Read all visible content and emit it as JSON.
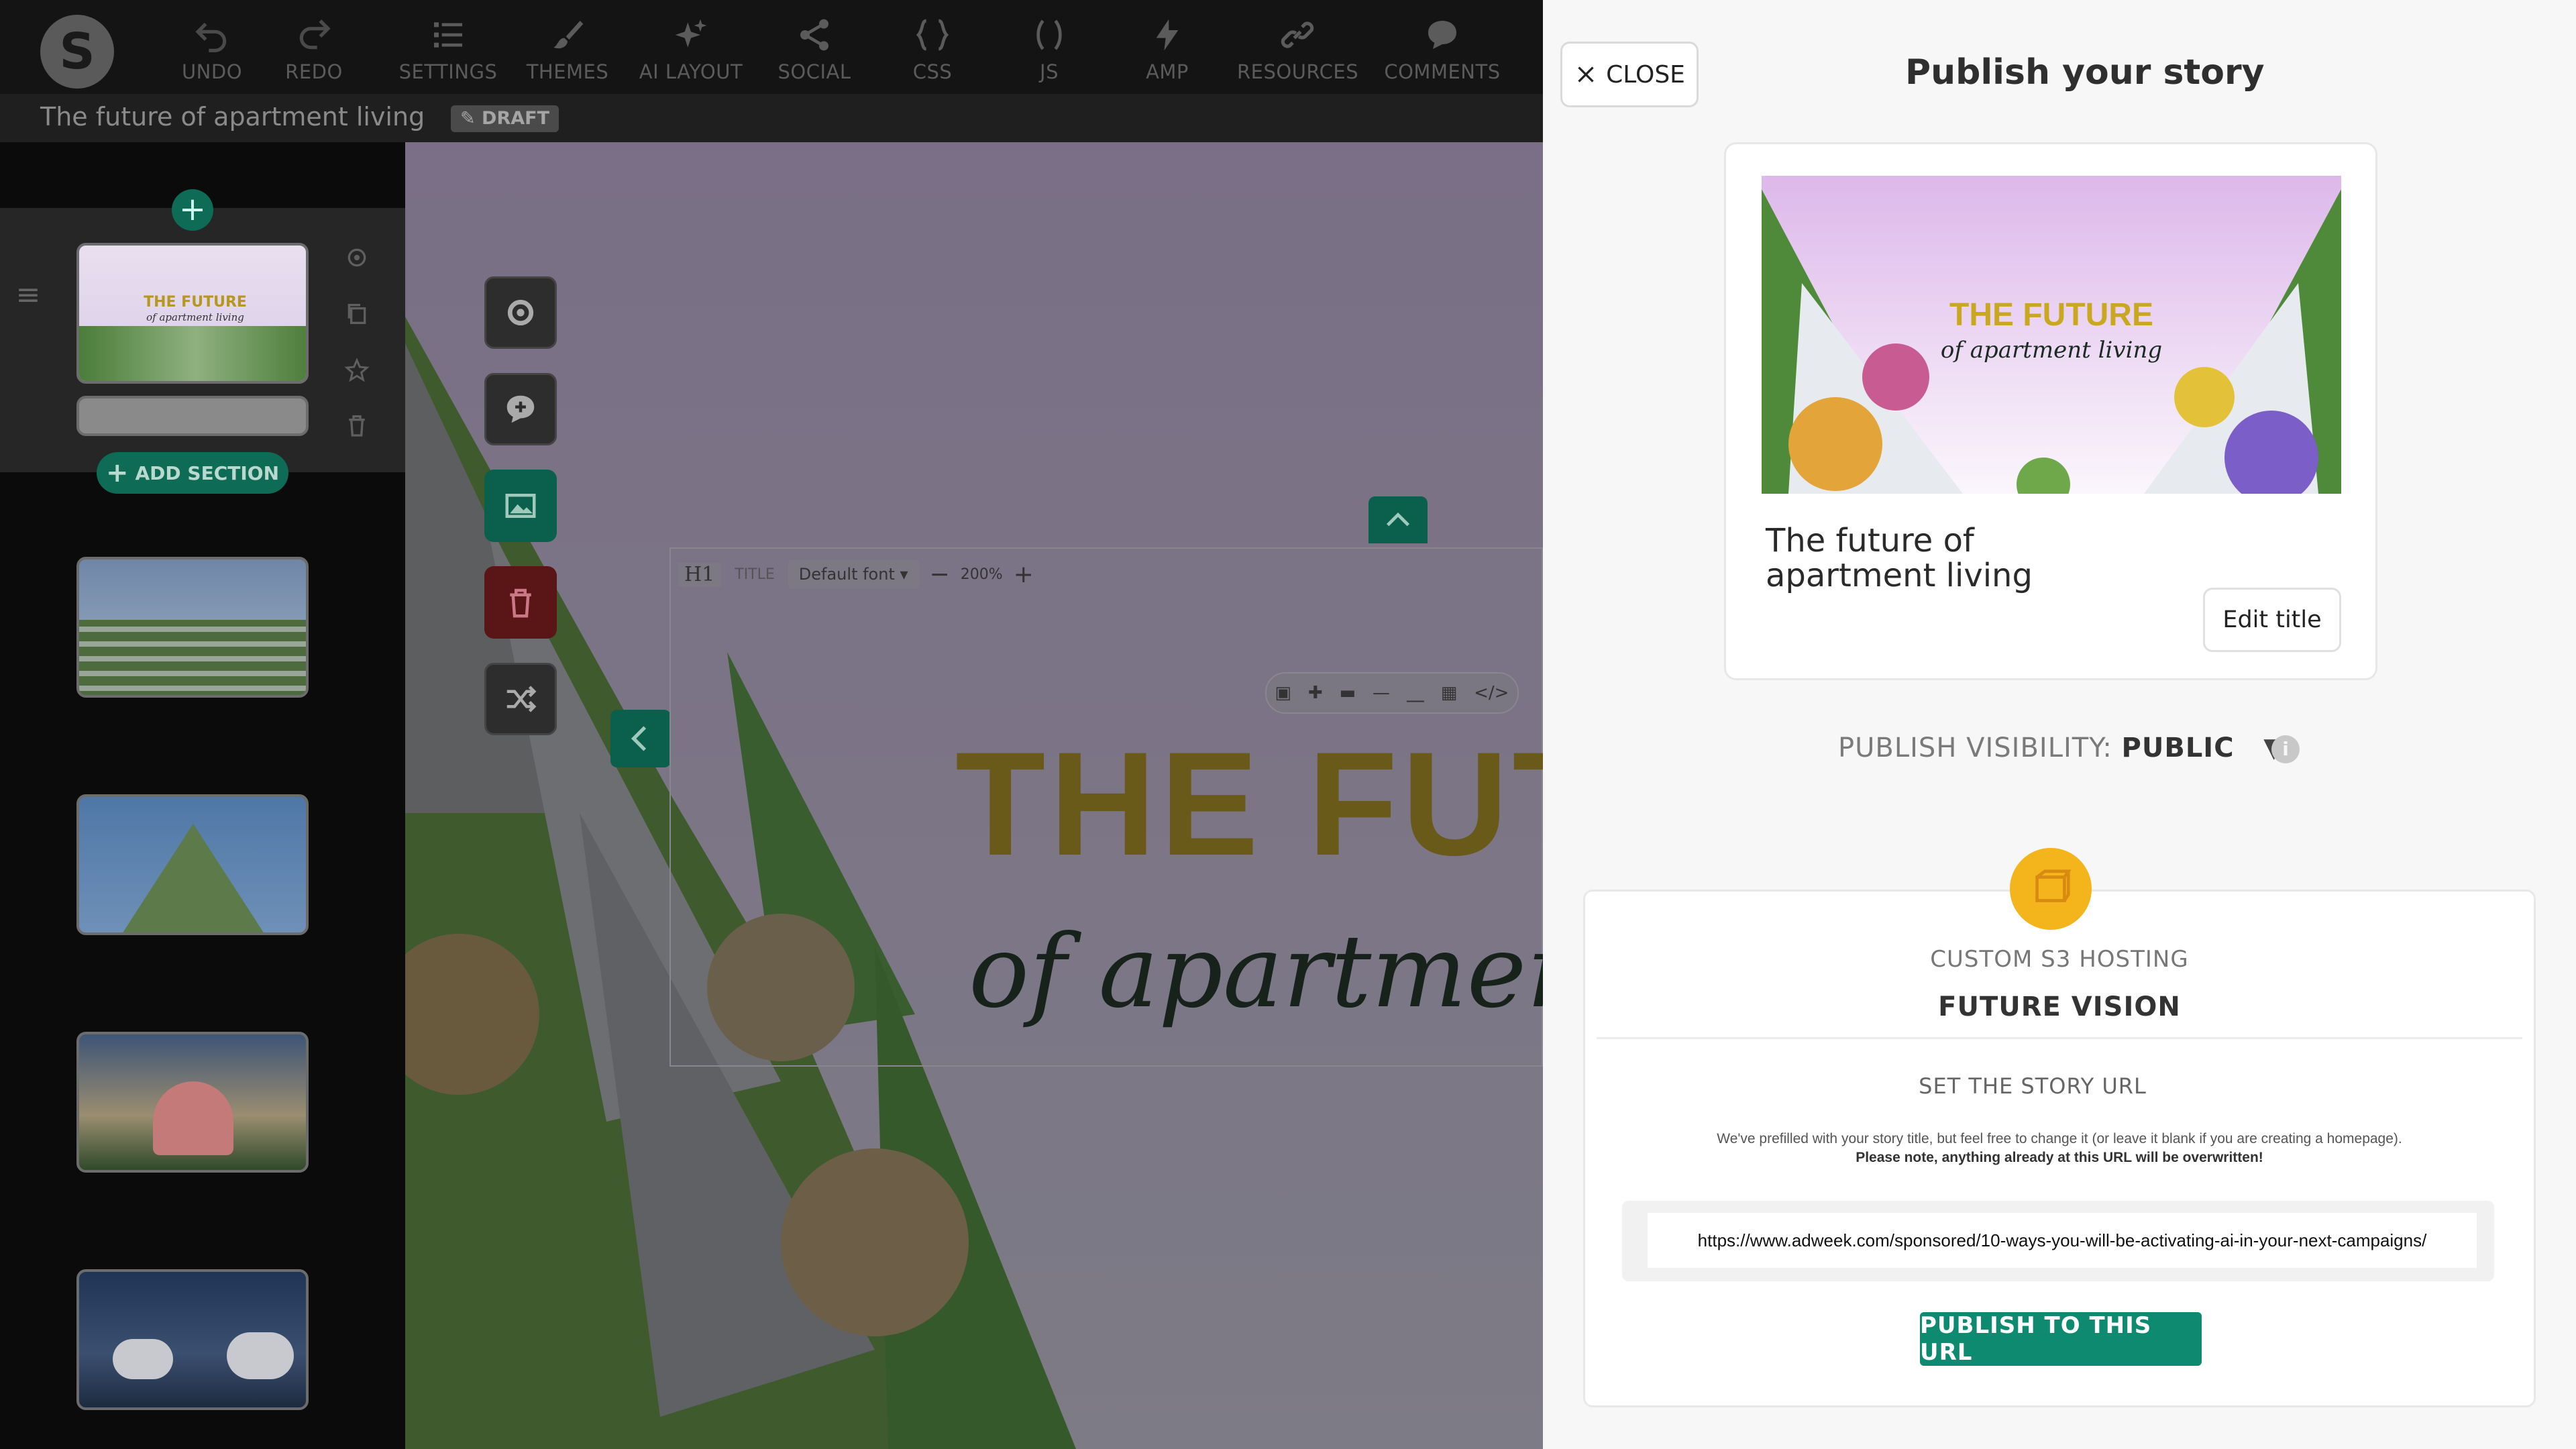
{
  "toolbar": {
    "logo": "S",
    "items": [
      {
        "label": "UNDO",
        "icon": "undo-icon"
      },
      {
        "label": "REDO",
        "icon": "redo-icon"
      },
      {
        "label": "SETTINGS",
        "icon": "list-icon"
      },
      {
        "label": "THEMES",
        "icon": "brush-icon"
      },
      {
        "label": "AI LAYOUT",
        "icon": "sparkle-icon"
      },
      {
        "label": "SOCIAL",
        "icon": "share-icon"
      },
      {
        "label": "CSS",
        "icon": "braces-icon"
      },
      {
        "label": "JS",
        "icon": "parens-icon"
      },
      {
        "label": "AMP",
        "icon": "bolt-icon"
      },
      {
        "label": "RESOURCES",
        "icon": "link-icon"
      },
      {
        "label": "COMMENTS",
        "icon": "chat-icon"
      }
    ]
  },
  "story": {
    "title": "The future of apartment living",
    "status": "DRAFT"
  },
  "sidebar": {
    "add_section_label": "ADD SECTION",
    "thumb_text": {
      "title": "THE FUTURE",
      "subtitle": "of apartment living"
    }
  },
  "editor": {
    "heading_tag": "H1",
    "element_type": "TITLE",
    "font": "Default font",
    "zoom": "200%",
    "headline": "THE FUTURE",
    "subheadline": "of apartment living"
  },
  "publish": {
    "close_label": "CLOSE",
    "title": "Publish your story",
    "card_headline": "THE FUTURE",
    "card_subheadline": "of apartment living",
    "card_title": "The future of apartment living",
    "edit_title_label": "Edit title",
    "visibility_label": "PUBLISH VISIBILITY:",
    "visibility_value": "PUBLIC",
    "hosting_label": "CUSTOM S3 HOSTING",
    "hosting_name": "FUTURE VISION",
    "url_heading": "SET THE STORY URL",
    "url_help": "We've prefilled with your story title, but feel free to change it (or leave it blank if you are creating a homepage).",
    "url_warning": "Please note, anything already at this URL will be overwritten!",
    "url_value": "https://www.adweek.com/sponsored/10-ways-you-will-be-activating-ai-in-your-next-campaigns/",
    "publish_button": "PUBLISH TO THIS URL"
  },
  "colors": {
    "accent": "#0d8a6f",
    "headline_gold": "#c9a81f",
    "danger": "#b71c1c",
    "host_icon": "#f4b41c"
  }
}
